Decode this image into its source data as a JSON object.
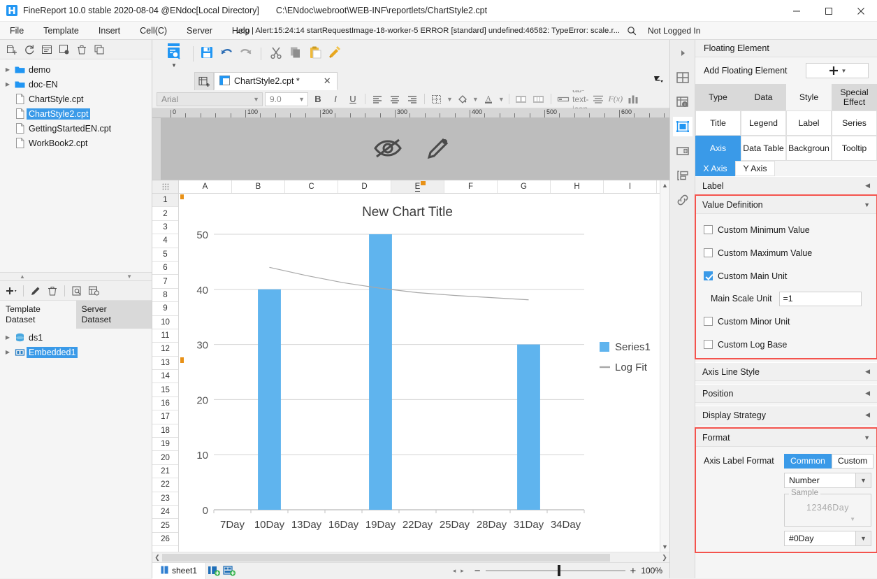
{
  "window": {
    "title": "FineReport 10.0 stable 2020-08-04 @ENdoc[Local Directory]",
    "path": "C:\\ENdoc\\webroot\\WEB-INF\\reportlets/ChartStyle2.cpt",
    "minimize": "─",
    "maximize": "☐",
    "close": "✕"
  },
  "menubar": {
    "items": [
      "File",
      "Template",
      "Insert",
      "Cell(C)",
      "Server",
      "Help"
    ],
    "log_text": "Log | Alert:15:24:14 startRequestImage-18-worker-5 ERROR [standard] undefined:46582: TypeError: scale.r...",
    "search_icon": "search-icon",
    "login_state": "Not Logged In"
  },
  "left_panel": {
    "toolbar_icons": [
      "new-template-icon",
      "refresh-icon",
      "rename-icon",
      "settings-icon",
      "delete-icon",
      "copy-icon"
    ],
    "tree": [
      {
        "label": "demo",
        "type": "folder",
        "expandable": true,
        "selected": false
      },
      {
        "label": "doc-EN",
        "type": "folder",
        "expandable": true,
        "selected": false
      },
      {
        "label": "ChartStyle.cpt",
        "type": "file",
        "expandable": false,
        "selected": false
      },
      {
        "label": "ChartStyle2.cpt",
        "type": "file",
        "expandable": false,
        "selected": true
      },
      {
        "label": "GettingStartedEN.cpt",
        "type": "file",
        "expandable": false,
        "selected": false
      },
      {
        "label": "WorkBook2.cpt",
        "type": "file",
        "expandable": false,
        "selected": false
      }
    ],
    "dataset_toolbar_icons": [
      "add-icon",
      "edit-icon",
      "delete-icon",
      "preview-icon",
      "search-dataset-icon"
    ],
    "dataset_tabs": [
      {
        "line1": "Template",
        "line2": "Dataset",
        "active": true
      },
      {
        "line1": "Server",
        "line2": "Dataset",
        "active": false
      }
    ],
    "datasets": [
      {
        "label": "ds1",
        "type": "db",
        "selected": false
      },
      {
        "label": "Embedded1",
        "type": "embedded",
        "selected": true
      }
    ]
  },
  "center": {
    "toolbar_icons": [
      "preview-icon",
      "save-icon",
      "undo-icon",
      "redo-icon",
      "cut-icon",
      "copy-icon",
      "paste-icon",
      "format-brush-icon"
    ],
    "new_tab_icon": "new-sheet-icon",
    "doc_tab": {
      "label": "ChartStyle2.cpt *",
      "icon": "report-icon",
      "close": "✕"
    },
    "tab_right_icon": "collapse-icon",
    "format_bar": {
      "font_name": "Arial",
      "font_size": "9.0",
      "bold": "B",
      "italic": "I",
      "underline": "U",
      "align_left": "align-left-icon",
      "align_center": "align-center-icon",
      "align_right": "align-right-icon",
      "border_icon": "border-icon",
      "fill_icon": "fill-color-icon",
      "font_color_icon": "font-color-icon",
      "merge_icon": "merge-cells-icon",
      "unmerge_icon": "unmerge-cells-icon",
      "cell_element_icon": "cell-element-icon",
      "text_icon": "ab-text-icon",
      "paragraph_icon": "paragraph-icon",
      "formula_icon": "F(x)",
      "chart_icon": "chart-icon"
    },
    "designer_overlay": [
      "eye-off-icon",
      "pencil-icon"
    ],
    "ruler_numbers": [
      "0",
      "100",
      "200",
      "300",
      "400",
      "500",
      "600"
    ],
    "columns": [
      "A",
      "B",
      "C",
      "D",
      "E",
      "F",
      "G",
      "H",
      "I"
    ],
    "selected_column": "E",
    "rows": [
      "1",
      "2",
      "3",
      "4",
      "5",
      "6",
      "7",
      "8",
      "9",
      "10",
      "11",
      "12",
      "13",
      "14",
      "15",
      "16",
      "17",
      "18",
      "19",
      "20",
      "21",
      "22",
      "23",
      "24",
      "25",
      "26"
    ],
    "selected_row": "1",
    "status": {
      "sheet_name": "sheet1",
      "sheet_icon": "sheet-icon",
      "add_sheet_icon": "add-sheet-icon",
      "add_polysheet_icon": "add-polysheet-icon",
      "prev_arrow": "◂",
      "next_arrow": "▸",
      "zoom_out": "−",
      "zoom_in": "+",
      "zoom_level": "100%"
    }
  },
  "chart_data": {
    "type": "bar",
    "title": "New Chart Title",
    "categories": [
      "7Day",
      "10Day",
      "13Day",
      "16Day",
      "19Day",
      "22Day",
      "25Day",
      "28Day",
      "31Day",
      "34Day"
    ],
    "series": [
      {
        "name": "Series1",
        "type": "bar",
        "color": "#5fb4ee",
        "values": [
          null,
          40,
          null,
          null,
          50,
          null,
          null,
          null,
          30,
          null
        ]
      },
      {
        "name": "Log Fit",
        "type": "line",
        "color": "#a8a8a8",
        "values": [
          null,
          44.0,
          42.5,
          41.2,
          40.2,
          39.4,
          38.9,
          38.5,
          38.1,
          null
        ]
      }
    ],
    "xlabel": "",
    "ylabel": "",
    "ylim": [
      0,
      50
    ],
    "yticks": [
      "0",
      "10",
      "20",
      "30",
      "40",
      "50"
    ],
    "grid": true,
    "legend_position": "right",
    "legend": [
      "Series1",
      "Log Fit"
    ]
  },
  "right_panel": {
    "side_icons": [
      "expand-arrow-icon",
      "cell-attributes-icon",
      "cell-element-info-icon",
      "floating-element-icon",
      "widget-settings-icon",
      "conditional-attributes-icon",
      "hyperlink-icon"
    ],
    "header": "Floating Element",
    "add_floating_label": "Add Floating Element",
    "add_button_icon": "plus-dropdown-icon",
    "tabs_top": [
      {
        "label": "Type",
        "active": false
      },
      {
        "label": "Data",
        "active": false
      },
      {
        "label": "Style",
        "active": true
      },
      {
        "label": "Special Effect",
        "active": false
      }
    ],
    "style_grid_row1": [
      {
        "label": "Title",
        "active": false
      },
      {
        "label": "Legend",
        "active": false
      },
      {
        "label": "Label",
        "active": false
      },
      {
        "label": "Series",
        "active": false
      }
    ],
    "style_grid_row2": [
      {
        "label": "Axis",
        "active": true
      },
      {
        "label": "Data Table",
        "active": false
      },
      {
        "label": "Backgroun",
        "active": false
      },
      {
        "label": "Tooltip",
        "active": false
      }
    ],
    "axis_tabs": [
      {
        "label": "X Axis",
        "active": true
      },
      {
        "label": "Y Axis",
        "active": false
      }
    ],
    "sections": {
      "label": {
        "title": "Label",
        "collapsed": true
      },
      "value_definition": {
        "title": "Value Definition",
        "collapsed": false,
        "highlighted": true,
        "checkboxes": [
          {
            "label": "Custom Minimum Value",
            "checked": false
          },
          {
            "label": "Custom Maximum Value",
            "checked": false
          },
          {
            "label": "Custom Main Unit",
            "checked": true
          }
        ],
        "main_scale_unit_label": "Main Scale Unit",
        "main_scale_unit_value": "=1",
        "checkboxes_after": [
          {
            "label": "Custom Minor Unit",
            "checked": false
          },
          {
            "label": "Custom Log Base",
            "checked": false
          }
        ]
      },
      "axis_line_style": {
        "title": "Axis Line Style",
        "collapsed": true
      },
      "position": {
        "title": "Position",
        "collapsed": true
      },
      "display_strategy": {
        "title": "Display Strategy",
        "collapsed": true
      },
      "format": {
        "title": "Format",
        "collapsed": false,
        "highlighted": true,
        "axis_label_format_label": "Axis Label Format",
        "seg_common": "Common",
        "seg_custom": "Custom",
        "seg_active": "Common",
        "number_type": "Number",
        "sample_legend": "Sample",
        "sample_value": "12346Day",
        "pattern": "#0Day"
      }
    }
  },
  "colors": {
    "accent": "#3a9ae8",
    "bar": "#5fb4ee",
    "highlight_border": "#f4534d",
    "line": "#a8a8a8"
  }
}
